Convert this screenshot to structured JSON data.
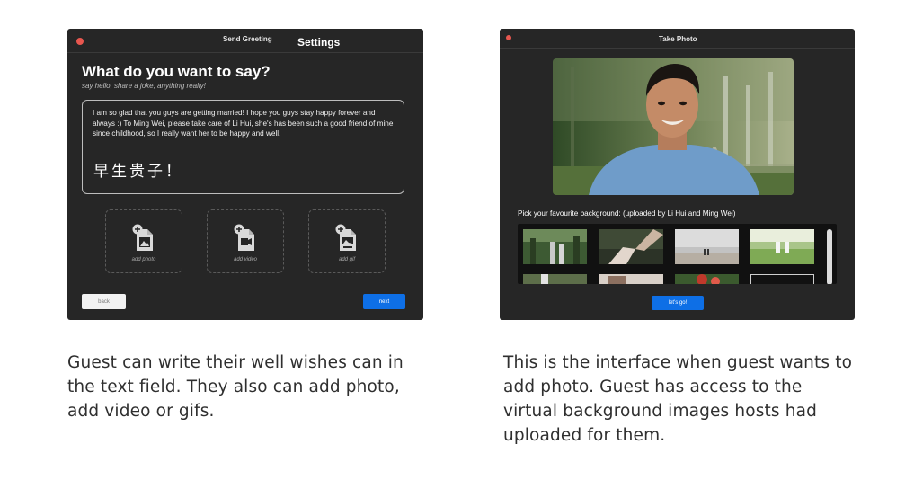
{
  "greeting_window": {
    "title_small": "Send Greeting",
    "title_large": "Settings",
    "heading": "What do you want to say?",
    "subheading": "say hello, share a joke, anything really!",
    "message_text": "I am so glad that you guys are getting married!  I hope you guys stay happy forever and always :) To Ming Wei, please take care of Li Hui, she's has been such a good friend of mine since childhood, so I really want her to be happy and well.",
    "handwriting_text": "早生贵子！",
    "attachments": [
      {
        "label": "add photo",
        "icon": "add-photo-icon"
      },
      {
        "label": "add video",
        "icon": "add-video-icon"
      },
      {
        "label": "add gif",
        "icon": "add-gif-icon"
      }
    ],
    "back_label": "back",
    "next_label": "next",
    "colors": {
      "background": "#262626",
      "accent": "#0e6fe6",
      "close": "#e8574f"
    }
  },
  "photo_window": {
    "title": "Take Photo",
    "camera_icon": "camera-preview-person",
    "pick_label": "Pick your favourite background: (uploaded by Li Hui and Ming Wei)",
    "go_label": "let's go!"
  },
  "captions": {
    "left": "Guest can write their well wishes can in the text field. They also can add photo, add video or gifs.",
    "right": "This is the interface when guest wants to add photo. Guest has access to the virtual background images hosts had uploaded for them."
  }
}
